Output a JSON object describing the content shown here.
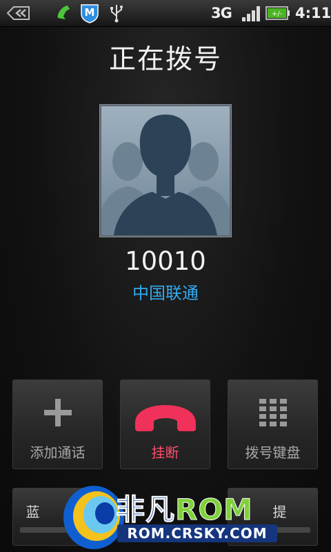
{
  "status_bar": {
    "network": "3G",
    "time": "4:11",
    "battery_text": "+/-",
    "icons": [
      "back-icon",
      "phone-icon",
      "shield-m-icon",
      "usb-icon",
      "signal-icon",
      "battery-icon"
    ]
  },
  "screen": {
    "title": "正在拨号",
    "number": "10010",
    "carrier": "中国联通"
  },
  "buttons": {
    "add_call": "添加通话",
    "end_call": "挂断",
    "dialpad": "拨号键盘",
    "bluetooth_partial": "蓝",
    "right_partial": "提"
  },
  "watermark": {
    "brand_cn": "非凡",
    "brand_en": "ROM",
    "url": "ROM.CRSKY.COM"
  },
  "colors": {
    "carrier": "#33aaf0",
    "end_call": "#ff4f70",
    "background": "#0c0c0c"
  }
}
